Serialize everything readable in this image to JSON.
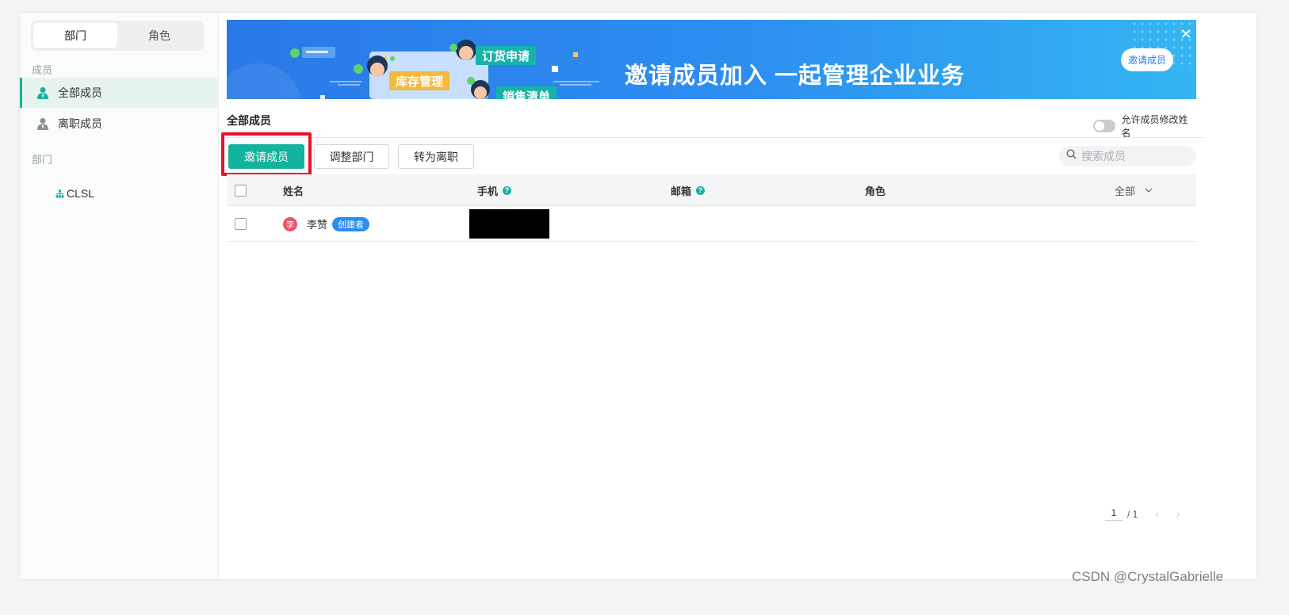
{
  "sidebar": {
    "tabs": [
      "部门",
      "角色"
    ],
    "members_group": "成员",
    "items": [
      {
        "label": "全部成员",
        "icon": "user-icon",
        "active": true
      },
      {
        "label": "离职成员",
        "icon": "user-icon",
        "active": false
      }
    ],
    "dept_group": "部门",
    "dept_tree": [
      {
        "label": "CLSL",
        "icon": "org-tree-icon"
      }
    ]
  },
  "banner": {
    "title": "邀请成员加入  一起管理企业业务",
    "button": "邀请成员",
    "close": "✕",
    "tags": [
      "订货申请",
      "库存管理",
      "销售清单"
    ]
  },
  "main": {
    "title": "全部成员",
    "toggle_label": "允许成员修改姓名",
    "toggle_on": false,
    "actions": {
      "invite": "邀请成员",
      "adjust_dept": "调整部门",
      "resign": "转为离职"
    },
    "search_placeholder": "搜索成员"
  },
  "table": {
    "columns": {
      "name": "姓名",
      "phone": "手机",
      "email": "邮箱",
      "role": "角色",
      "filter": "全部"
    },
    "help_glyph": "?",
    "rows": [
      {
        "avatar": "李",
        "name": "李赞",
        "badge": "创建者",
        "phone_redacted": true,
        "email": "",
        "role": ""
      }
    ]
  },
  "pagination": {
    "current": "1",
    "total": "/ 1",
    "prev": "‹",
    "next": "›"
  },
  "watermark": "CSDN @CrystalGabrielle",
  "colors": {
    "accent": "#14b39d",
    "banner_blue": "#2d8ff0",
    "highlight_red": "#e8102b",
    "badge_blue": "#2d8df0"
  }
}
